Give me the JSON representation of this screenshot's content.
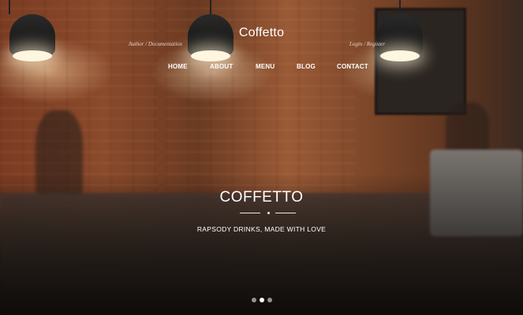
{
  "header": {
    "left_links": "Author / Documentation",
    "right_links": "Login / Register",
    "brand": "Coffetto"
  },
  "menu": {
    "items": [
      "HOME",
      "ABOUT",
      "MENU",
      "BLOG",
      "CONTACT"
    ]
  },
  "hero": {
    "title": "COFFETTO",
    "subtitle": "RAPSODY DRINKS, MADE WITH LOVE"
  },
  "slider": {
    "slide_count": 3,
    "active_index": 1
  },
  "colors": {
    "text": "#ffffff",
    "accent_light": "#f0e8e0"
  }
}
